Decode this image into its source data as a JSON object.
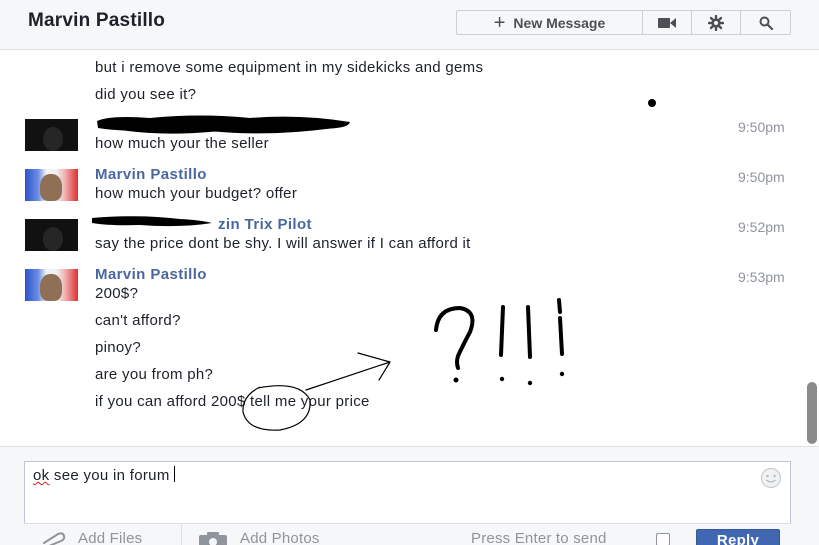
{
  "header": {
    "title": "Marvin Pastillo",
    "new_message_label": "New Message",
    "icons": [
      "video-call-icon",
      "gear-icon",
      "search-icon"
    ]
  },
  "messages": {
    "top_lines": [
      "but i remove some equipment in my sidekicks and gems",
      "did you see it?"
    ],
    "groups": [
      {
        "sender": "",
        "time": "9:50pm",
        "avatar": "dark-avatar",
        "lines": [
          "how much your the seller"
        ]
      },
      {
        "sender": "Marvin Pastillo",
        "time": "9:50pm",
        "avatar": "marvin-avatar",
        "lines": [
          "how much your budget? offer"
        ]
      },
      {
        "sender": "zin Trix Pilot",
        "time": "9:52pm",
        "avatar": "dark-avatar",
        "lines": [
          "say the price dont be shy. I will answer if I can afford it"
        ]
      },
      {
        "sender": "Marvin Pastillo",
        "time": "9:53pm",
        "avatar": "marvin-avatar",
        "lines": [
          "200$?",
          "can't afford?",
          "pinoy?",
          "are you from ph?",
          "if you can afford 200$ tell me your price"
        ]
      }
    ]
  },
  "composer": {
    "value_first_word": "ok",
    "value_rest": " see you in forum",
    "add_files_label": "Add Files",
    "add_photos_label": "Add Photos",
    "press_enter_label": "Press Enter to send",
    "press_enter_checked": false,
    "reply_label": "Reply"
  },
  "colors": {
    "sender_name": "#4b67a1",
    "reply_button": "#4267b2",
    "timestamp": "#90949c",
    "redaction": "#000000"
  }
}
